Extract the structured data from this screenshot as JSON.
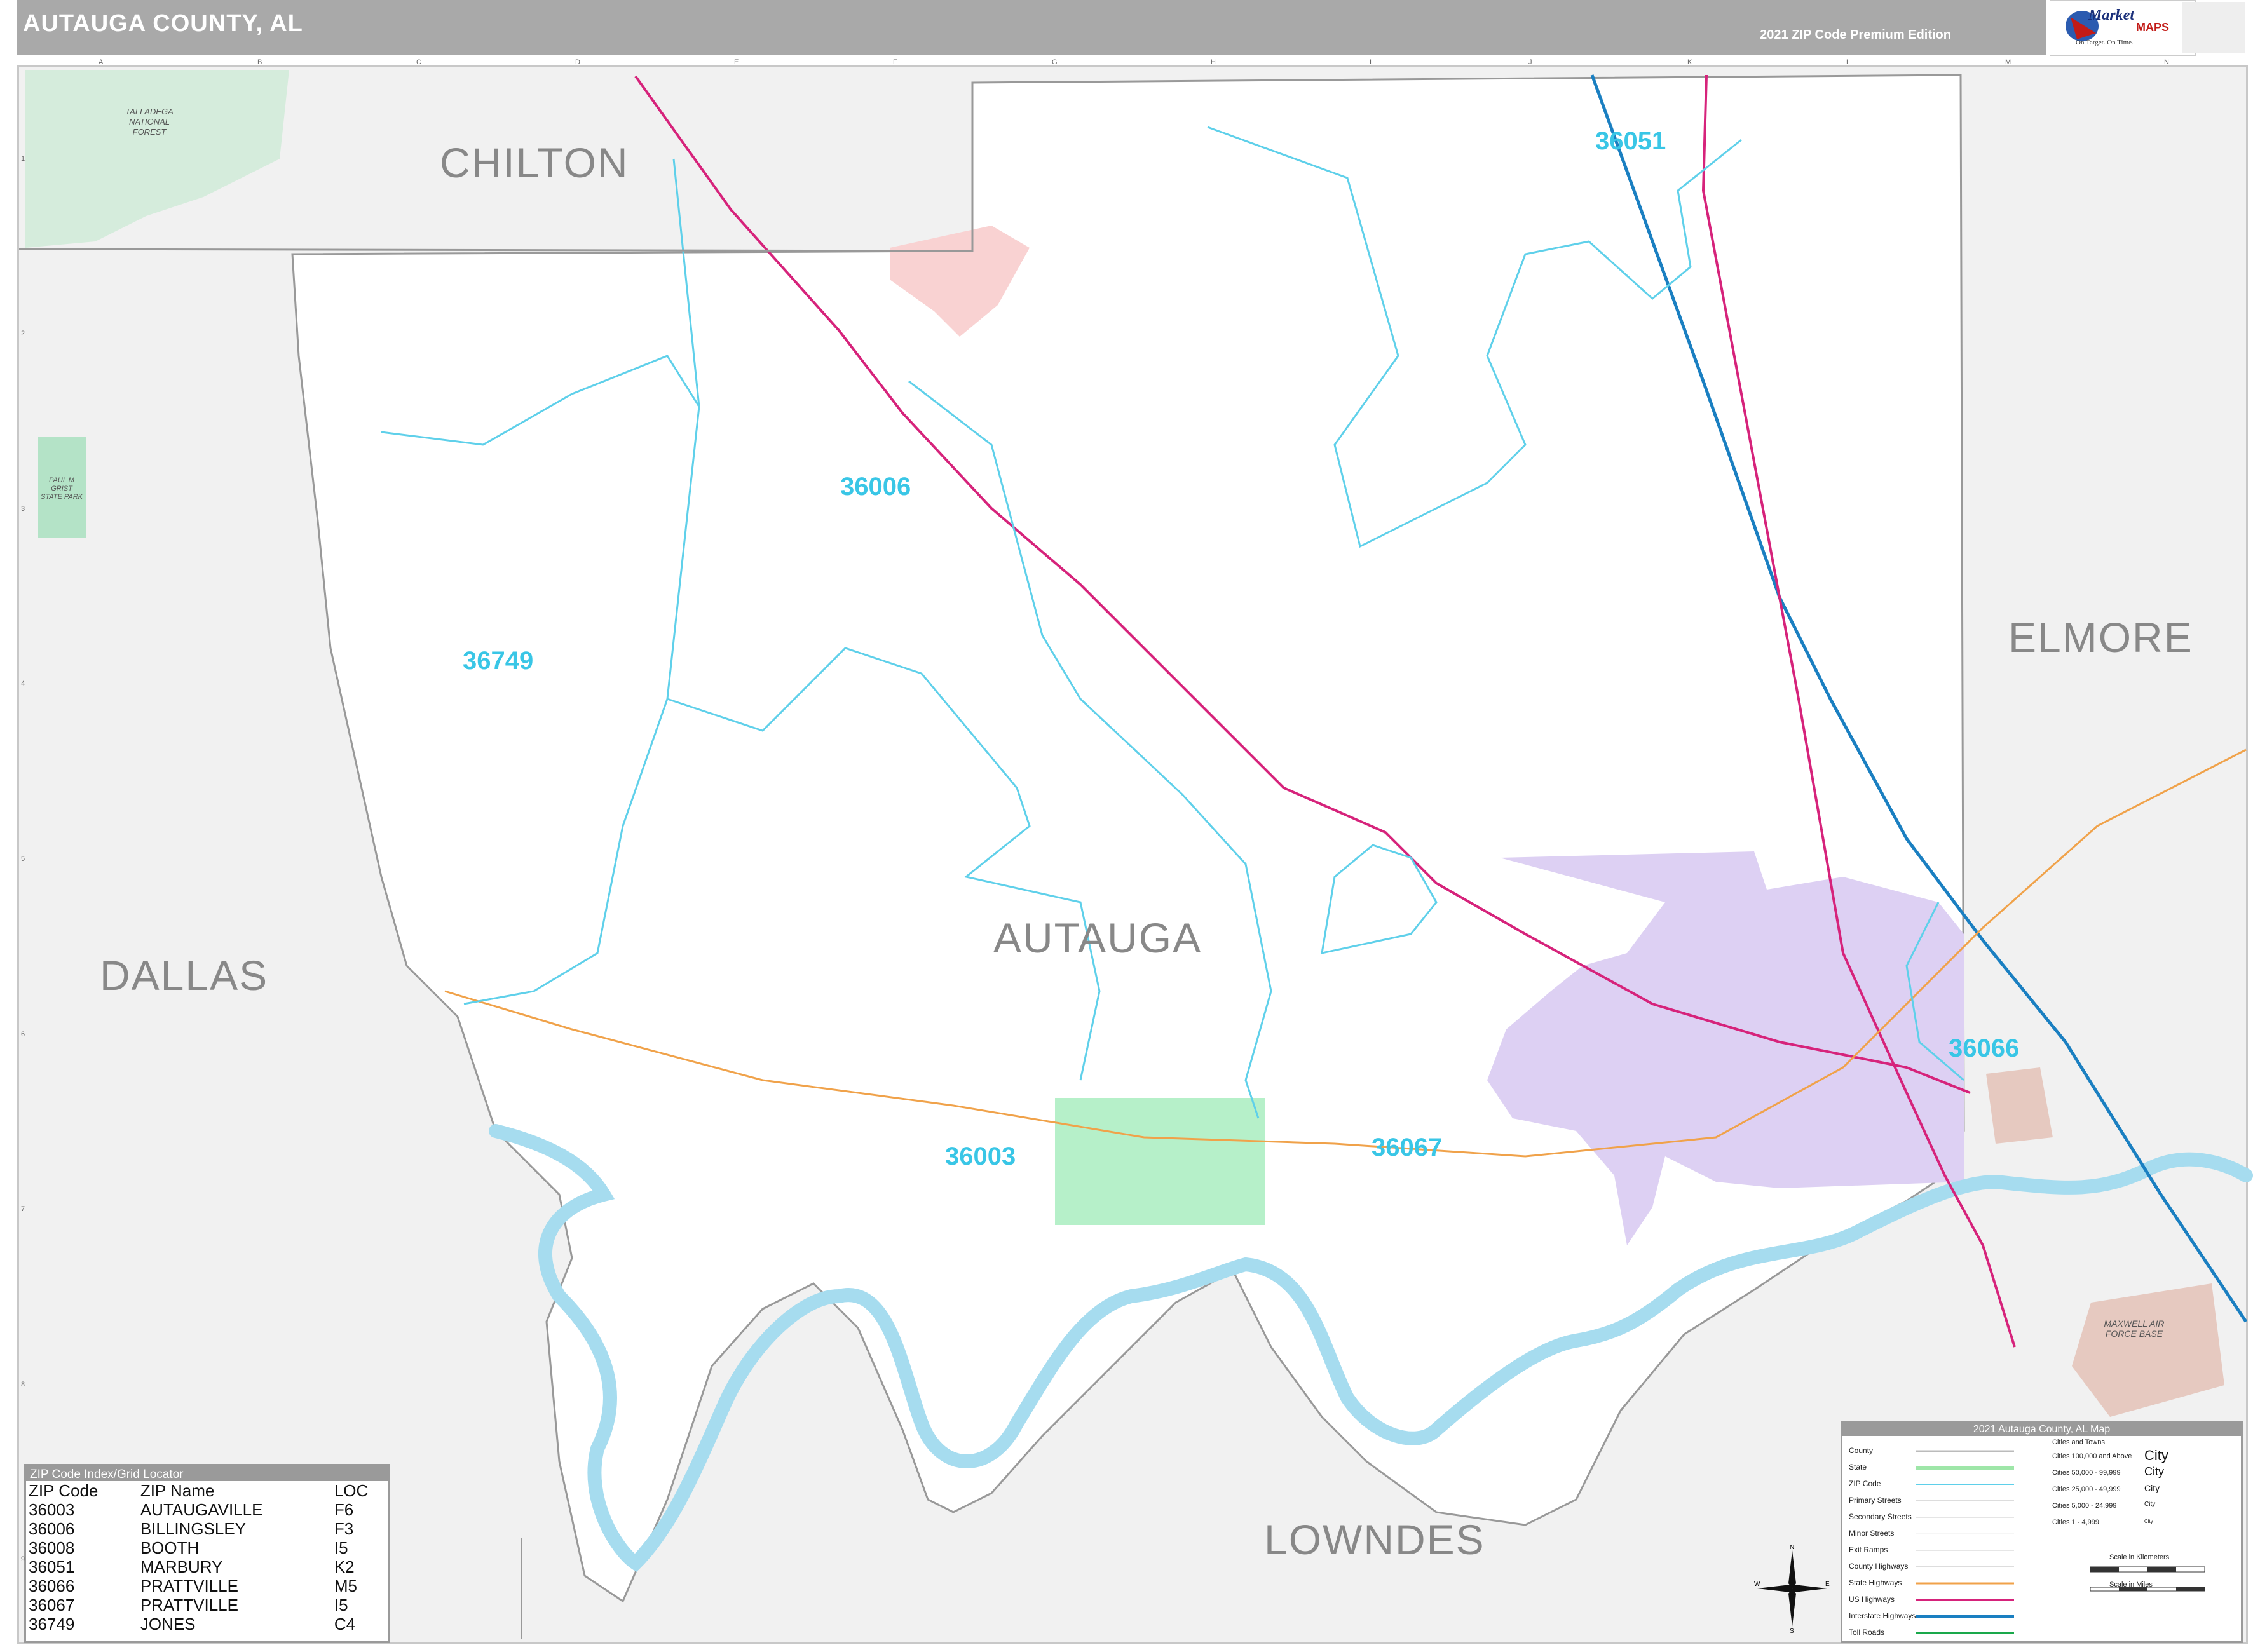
{
  "header": {
    "title": "AUTAUGA COUNTY, AL",
    "edition": "2021 ZIP Code Premium Edition"
  },
  "brand": {
    "name": "Market",
    "sub": "MAPS",
    "tagline": "On Target. On Time."
  },
  "counties": {
    "center": "AUTAUGA",
    "neighbors": [
      "CHILTON",
      "ELMORE",
      "DALLAS",
      "LOWNDES"
    ]
  },
  "zips": [
    {
      "code": "36051"
    },
    {
      "code": "36006"
    },
    {
      "code": "36749"
    },
    {
      "code": "36003"
    },
    {
      "code": "36067"
    },
    {
      "code": "36066"
    }
  ],
  "parks": {
    "talladega": "TALLADEGA NATIONAL FOREST",
    "grist": "PAUL M GRIST STATE PARK",
    "maxwell": "MAXWELL AIR FORCE BASE"
  },
  "zip_index": {
    "title": "ZIP Code Index/Grid Locator",
    "headers": [
      "ZIP Code",
      "ZIP Name",
      "LOC"
    ],
    "rows": [
      [
        "36003",
        "AUTAUGAVILLE",
        "F6"
      ],
      [
        "36006",
        "BILLINGSLEY",
        "F3"
      ],
      [
        "36008",
        "BOOTH",
        "I5"
      ],
      [
        "36051",
        "MARBURY",
        "K2"
      ],
      [
        "36066",
        "PRATTVILLE",
        "M5"
      ],
      [
        "36067",
        "PRATTVILLE",
        "I5"
      ],
      [
        "36749",
        "JONES",
        "C4"
      ]
    ]
  },
  "legend": {
    "title": "2021 Autauga County, AL Map",
    "items": [
      "County",
      "State",
      "ZIP Code",
      "Primary Streets",
      "Secondary Streets",
      "Minor Streets",
      "Exit Ramps",
      "County Highways",
      "State Highways",
      "US Highways",
      "Interstate Highways",
      "Toll Roads"
    ],
    "cities_header": "Cities and Towns",
    "cities": [
      {
        "range": "Cities 100,000 and Above",
        "sample": "City"
      },
      {
        "range": "Cities 50,000 - 99,999",
        "sample": "City"
      },
      {
        "range": "Cities 25,000 - 49,999",
        "sample": "City"
      },
      {
        "range": "Cities 5,000 - 24,999",
        "sample": "City"
      },
      {
        "range": "Cities 1 - 4,999",
        "sample": "City"
      }
    ],
    "scale_km": "Scale in Kilometers",
    "scale_mi": "Scale in Miles"
  },
  "grid": {
    "columns": [
      "A",
      "B",
      "C",
      "D",
      "E",
      "F",
      "G",
      "H",
      "I",
      "J",
      "K",
      "L",
      "M",
      "N"
    ],
    "rows": [
      "1",
      "2",
      "3",
      "4",
      "5",
      "6",
      "7",
      "8",
      "9"
    ]
  },
  "colors": {
    "zip_text": "#39c6e6",
    "zip_line": "#5fd0ea",
    "water": "#a6dcef",
    "interstate": "#1a7fc1",
    "us_highway": "#d6237b",
    "state_highway": "#f0a24a",
    "prattville": "#d9c9f0",
    "autaugaville": "#b6f0c9",
    "outside": "#f1f1f1",
    "forest": "#d5ecdc"
  }
}
